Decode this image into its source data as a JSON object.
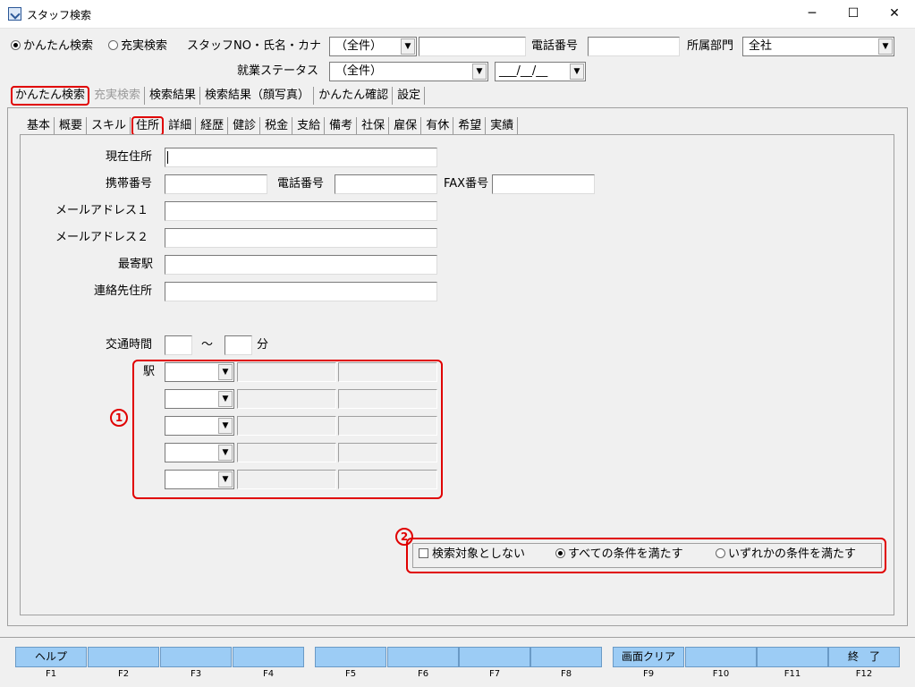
{
  "window": {
    "title": "スタッフ検索",
    "minimize": "─",
    "maximize": "☐",
    "close": "✕"
  },
  "header": {
    "mode_easy": "かんたん検索",
    "mode_full": "充実検索",
    "staff_label": "スタッフNO・氏名・カナ",
    "staff_select": "（全件）",
    "staff_input": "",
    "phone_label": "電話番号",
    "phone_input": "",
    "dept_label": "所属部門",
    "dept_select": "全社",
    "status_label": "就業ステータス",
    "status_select": "（全件）",
    "date_value": "___/__/__"
  },
  "main_tabs": [
    "かんたん検索",
    "充実検索",
    "検索結果",
    "検索結果（顔写真）",
    "かんたん確認",
    "設定"
  ],
  "sub_tabs": [
    "基本",
    "概要",
    "スキル",
    "住所",
    "詳細",
    "経歴",
    "健診",
    "税金",
    "支給",
    "備考",
    "社保",
    "雇保",
    "有休",
    "希望",
    "実績"
  ],
  "form": {
    "address_label": "現在住所",
    "mobile_label": "携帯番号",
    "tel_label": "電話番号",
    "fax_label": "FAX番号",
    "mail1_label": "メールアドレス１",
    "mail2_label": "メールアドレス２",
    "station_label": "最寄駅",
    "contact_label": "連絡先住所",
    "commute_label": "交通時間",
    "tilde": "～",
    "minutes": "分",
    "eki_label": "駅"
  },
  "markers": {
    "m1": "1",
    "m2": "2"
  },
  "condition": {
    "exclude": "検索対象としない",
    "all": "すべての条件を満たす",
    "any": "いずれかの条件を満たす"
  },
  "fkeys": [
    {
      "label": "ヘルプ",
      "key": "F1"
    },
    {
      "label": "",
      "key": "F2"
    },
    {
      "label": "",
      "key": "F3"
    },
    {
      "label": "",
      "key": "F4"
    },
    {
      "label": "",
      "key": "F5"
    },
    {
      "label": "",
      "key": "F6"
    },
    {
      "label": "",
      "key": "F7"
    },
    {
      "label": "",
      "key": "F8"
    },
    {
      "label": "画面クリア",
      "key": "F9"
    },
    {
      "label": "",
      "key": "F10"
    },
    {
      "label": "",
      "key": "F11"
    },
    {
      "label": "終　了",
      "key": "F12"
    }
  ]
}
